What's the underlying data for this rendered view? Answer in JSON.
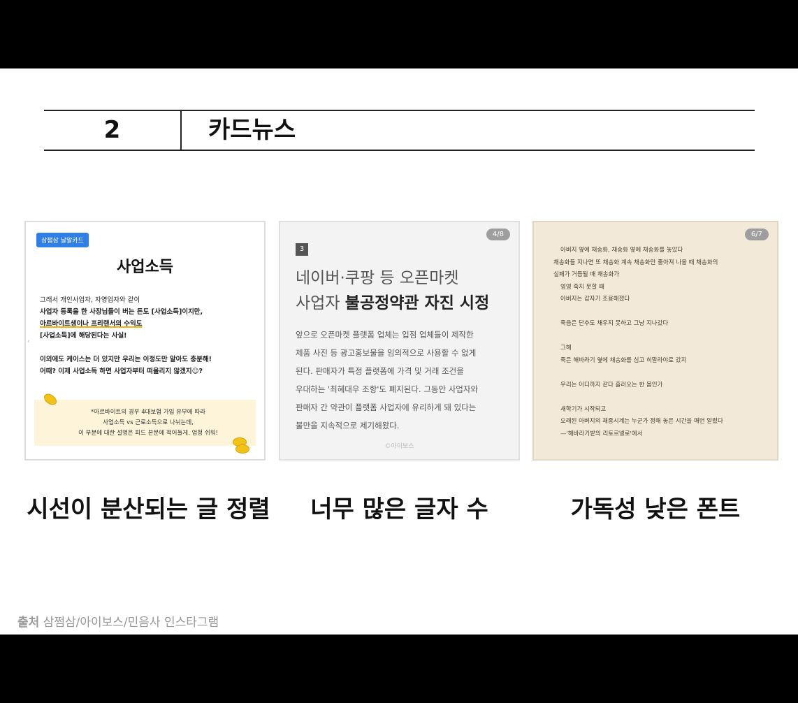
{
  "header": {
    "number": "2",
    "title": "카드뉴스"
  },
  "card1": {
    "badge": "삼쩜삼 날말카드",
    "title": "사업소득",
    "lines": [
      "그래서 개인사업자, 자영업자와 같이",
      "사업자 등록을 한 사장님들이 버는 돈도 [사업소득]이지만,",
      "아르바이트생이나 프리랜서의 수익도",
      "[사업소득]에 해당된다는 사실!",
      "",
      "이외에도 케이스는 더 있지만 우리는 이정도만 알아도 충분해!",
      "어때? 이제 사업소득 하면 사업자부터 떠올리지 않겠지😉?"
    ],
    "note": [
      "*아르바이트의 경우 4대보험 가입 유무에 따라",
      "사업소득 vs 근로소득으로 나뉘는데,",
      "이 부분에 대한 설명은 피드 본문에 적어둘게. 엄청 쉬워!"
    ]
  },
  "card2": {
    "page": "4/8",
    "number": "3",
    "headline1": "네이버·쿠팡 등 오픈마켓",
    "headline2_plain": "사업자 ",
    "headline2_bold": "불공정약관 자진 시정",
    "lines": [
      "앞으로 오픈마켓 플랫폼 업체는 입점 업체들이 제작한",
      "제품 사진 등 광고홍보물을 임의적으로 사용할 수 없게",
      "된다. 판매자가 특정 플랫폼에 가격 및 거래 조건을",
      "우대하는 '최혜대우 조항'도 폐지된다. 그동안 사업자와",
      "판매자 간 약관이 플랫폼 사업자에 유리하게 돼 있다는",
      "불만을 지속적으로 제기해왔다."
    ],
    "source": "©아이보스"
  },
  "card3": {
    "page": "6/7",
    "lines": [
      "아버지 옆에 채송화, 채송화 옆에 채송화를 놓았다",
      "채송화들 지나면 또 채송화 계속 채송화만 줄아져 나올 때 채송화의",
      "실패가 거듭될 때 채송화가",
      "영영 죽지 못할 때",
      "아버지는 갑자기 조용해졌다",
      "",
      "죽음은 단추도 채우지 못하고 그냥 지나갔다",
      "",
      "그해",
      "죽은 해바라기 옆에 채송화를 심고 히말라야로 갔지",
      "",
      "우리는 어디까지 같다 흘러오는 한 몸인가",
      "",
      "새학기가 시작되고",
      "오래된 아버지의 괘종시계는 누군가 정해 놓은 시간을 매번 알렸다",
      "—'해바라기밭의 리토르넬로'에서"
    ]
  },
  "captions": {
    "c1": "시선이 분산되는 글 정렬",
    "c2": "너무 많은 글자 수",
    "c3": "가독성 낮은 폰트"
  },
  "source": {
    "label": "출처",
    "text": "삼쩜삼/아이보스/민음사 인스타그램"
  },
  "colors": {
    "badge": "#2f7fe6",
    "coin": "#f2c21a",
    "card3_bg": "#f3e9d8"
  }
}
